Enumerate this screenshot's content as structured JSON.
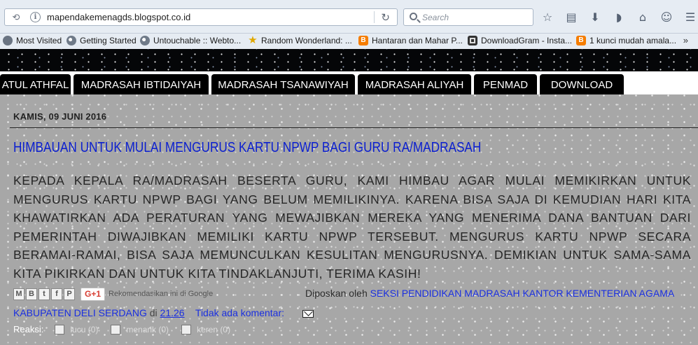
{
  "browser": {
    "url": "mapendakemenagds.blogspot.co.id",
    "search_placeholder": "Search",
    "bookmarks": [
      {
        "label": "Most Visited",
        "icon": "gear-icon"
      },
      {
        "label": "Getting Started",
        "icon": "globe-icon"
      },
      {
        "label": "Untouchable :: Webto...",
        "icon": "globe-icon"
      },
      {
        "label": "Random Wonderland: ...",
        "icon": "star-icon"
      },
      {
        "label": "Hantaran dan Mahar P...",
        "icon": "blogger-icon"
      },
      {
        "label": "DownloadGram - Insta...",
        "icon": "instagram-icon"
      },
      {
        "label": "1 kunci mudah amala...",
        "icon": "blogger-icon"
      }
    ],
    "bookmarks_more": "»"
  },
  "nav": {
    "tabs": [
      "ATUL ATHFAL",
      "MADRASAH IBTIDAIYAH",
      "MADRASAH TSANAWIYAH",
      "MADRASAH ALIYAH",
      "PENMAD",
      "DOWNLOAD"
    ]
  },
  "post": {
    "date": "KAMIS, 09 JUNI 2016",
    "title": "HIMBAUAN UNTUK MULAI MENGURUS KARTU NPWP BAGI GURU RA/MADRASAH",
    "body": "KEPADA KEPALA RA/MADRASAH BESERTA GURU, KAMI HIMBAU AGAR MULAI MEMIKIRKAN UNTUK MENGURUS KARTU NPWP BAGI YANG BELUM MEMILIKINYA. KARENA BISA SAJA DI KEMUDIAN HARI KITA KHAWATIRKAN ADA PERATURAN YANG MEWAJIBKAN MEREKA YANG MENERIMA DANA BANTUAN DARI PEMERINTAH DIWAJIBKAN MEMILIKI KARTU NPWP TERSEBUT. MENGURUS KARTU NPWP SECARA BERAMAI-RAMAI, BISA SAJA MEMUNCULKAN KESULITAN MENGURUSNYA. DEMIKIAN UNTUK SAMA-SAMA KITA PIKIRKAN DAN UNTUK KITA TINDAKLANJUTI, TERIMA KASIH!",
    "share": {
      "buttons": [
        "M",
        "B",
        "t",
        "f",
        "P"
      ],
      "gplus_label": "G+1",
      "recommend": "Rekomendasikan ini di Google"
    },
    "posted_by_label": "Diposkan oleh",
    "author_line1": "SEKSI PENDIDIKAN MADRASAH KANTOR KEMENTERIAN AGAMA",
    "author_line2": "KABUPATEN DELI SERDANG",
    "at_label": "di",
    "time": "21.26",
    "comments": "Tidak ada komentar:",
    "reactions_label": "Reaksi:",
    "reactions": [
      "lucu (0)",
      "menarik (0)",
      "keren (0)"
    ]
  }
}
